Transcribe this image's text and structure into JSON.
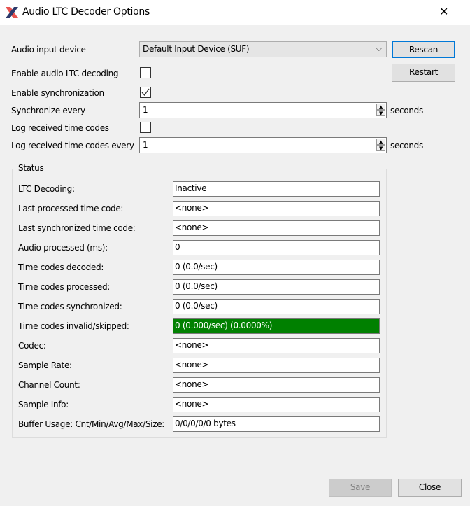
{
  "window": {
    "title": "Audio LTC Decoder Options",
    "close_glyph": "✕"
  },
  "form": {
    "audio_input_label": "Audio input device",
    "audio_input_value": "Default Input Device (SUF)",
    "rescan": "Rescan",
    "restart": "Restart",
    "enable_ltc_label": "Enable audio LTC decoding",
    "enable_ltc_checked": false,
    "enable_sync_label": "Enable synchronization",
    "enable_sync_checked": true,
    "sync_every_label": "Synchronize every",
    "sync_every_value": "1",
    "sync_unit": "seconds",
    "log_label": "Log received time codes",
    "log_checked": false,
    "log_every_label": "Log received time codes every",
    "log_every_value": "1",
    "log_unit": "seconds"
  },
  "status": {
    "title": "Status",
    "rows": [
      {
        "label": "LTC Decoding:",
        "value": "Inactive"
      },
      {
        "label": "Last processed time code:",
        "value": "<none>"
      },
      {
        "label": "Last synchronized time code:",
        "value": "<none>"
      },
      {
        "label": "Audio processed (ms):",
        "value": "0"
      },
      {
        "label": "Time codes decoded:",
        "value": "0 (0.0/sec)"
      },
      {
        "label": "Time codes processed:",
        "value": "0 (0.0/sec)"
      },
      {
        "label": "Time codes synchronized:",
        "value": "0 (0.0/sec)"
      },
      {
        "label": "Time codes invalid/skipped:",
        "value": "0 (0.000/sec) (0.0000%)",
        "highlight": "#008000"
      },
      {
        "label": "Codec:",
        "value": "<none>"
      },
      {
        "label": "Sample Rate:",
        "value": "<none>"
      },
      {
        "label": "Channel Count:",
        "value": "<none>"
      },
      {
        "label": "Sample Info:",
        "value": "<none>"
      },
      {
        "label": "Buffer Usage: Cnt/Min/Avg/Max/Size:",
        "value": "0/0/0/0/0 bytes"
      }
    ]
  },
  "footer": {
    "save": "Save",
    "close": "Close"
  }
}
